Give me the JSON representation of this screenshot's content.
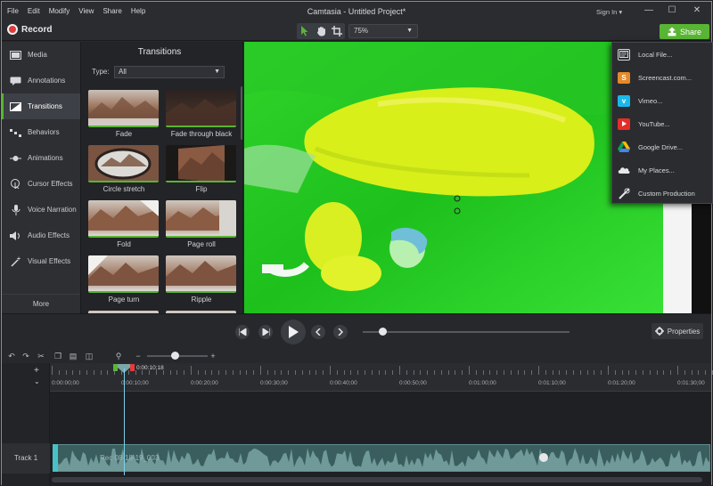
{
  "menubar": {
    "items": [
      "File",
      "Edit",
      "Modify",
      "View",
      "Share",
      "Help"
    ],
    "title": "Camtasia - Untitled Project*",
    "signin": "Sign In ▾"
  },
  "toolbar": {
    "record_label": "Record",
    "zoom_value": "75%",
    "share_label": "Share"
  },
  "leftnav": {
    "items": [
      {
        "label": "Media",
        "icon": "film-strip-icon"
      },
      {
        "label": "Annotations",
        "icon": "annotation-icon"
      },
      {
        "label": "Transitions",
        "icon": "transition-icon"
      },
      {
        "label": "Behaviors",
        "icon": "behaviors-icon"
      },
      {
        "label": "Animations",
        "icon": "animation-icon"
      },
      {
        "label": "Cursor Effects",
        "icon": "cursor-icon"
      },
      {
        "label": "Voice Narration",
        "icon": "microphone-icon"
      },
      {
        "label": "Audio Effects",
        "icon": "speaker-icon"
      },
      {
        "label": "Visual Effects",
        "icon": "magic-wand-icon"
      }
    ],
    "active": "Transitions",
    "more_label": "More"
  },
  "transitions": {
    "title": "Transitions",
    "type_label": "Type:",
    "type_value": "All",
    "tiles": [
      "Fade",
      "Fade through black",
      "Circle stretch",
      "Flip",
      "Fold",
      "Page roll",
      "Page turn",
      "Ripple"
    ]
  },
  "share_menu": {
    "items": [
      {
        "label": "Local File...",
        "icon": "local-file-icon",
        "color": "#3a3d42"
      },
      {
        "label": "Screencast.com...",
        "icon": "screencast-icon",
        "color": "#e58a2a"
      },
      {
        "label": "Vimeo...",
        "icon": "vimeo-icon",
        "color": "#1ab7ea"
      },
      {
        "label": "YouTube...",
        "icon": "youtube-icon",
        "color": "#e52d27"
      },
      {
        "label": "Google Drive...",
        "icon": "google-drive-icon",
        "color": "#2a2c30"
      },
      {
        "label": "My Places...",
        "icon": "cloud-icon",
        "color": "#2a2c30"
      },
      {
        "label": "Custom Production",
        "icon": "tools-icon",
        "color": "#2a2c30"
      }
    ]
  },
  "playback": {
    "properties_label": "Properties"
  },
  "timeline": {
    "playhead_time": "0:00:10;18",
    "ruler_labels": [
      "0:00:00;00",
      "0:00:10;00",
      "0:00:20;00",
      "0:00:30;00",
      "0:00:40;00",
      "0:00:50;00",
      "0:01:00;00",
      "0:01:10;00",
      "0:01:20;00",
      "0:01:30;00"
    ],
    "track_label": "Track 1",
    "clip_label": "Rec 08-18-19_003"
  },
  "colors": {
    "accent": "#59b534",
    "record": "#e23b3b",
    "playhead": "#7fd0e8"
  }
}
